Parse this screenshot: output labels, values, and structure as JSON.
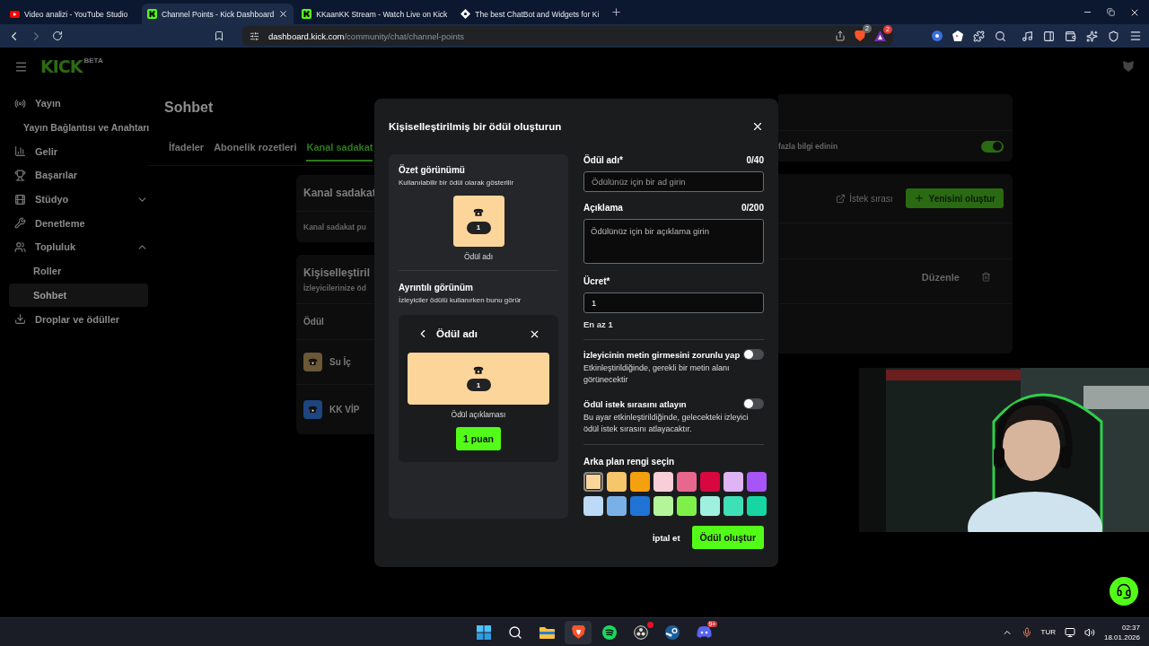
{
  "browser": {
    "tabs": [
      {
        "title": "Video analizi - YouTube Studio",
        "kind": "video",
        "selected": false
      },
      {
        "title": "Channel Points - Kick Dashboard",
        "kind": "kick",
        "selected": true
      },
      {
        "title": "KKaanKK Stream - Watch Live on Kick",
        "kind": "kick",
        "selected": false
      },
      {
        "title": "The best ChatBot and Widgets for Ki",
        "kind": "bot",
        "selected": false
      }
    ],
    "url_host": "dashboard.kick.com",
    "url_path": "/community/chat/channel-points",
    "shield_badge": "2",
    "triangle_badge": "2"
  },
  "header": {
    "logo": "KICK",
    "logo_tag": "BETA"
  },
  "sidebar": {
    "items": [
      {
        "label": "Yayın",
        "kind": "broadcast",
        "selected": false,
        "children": [
          {
            "label": "Yayın Bağlantısı ve Anahtarı",
            "selected": false
          }
        ]
      },
      {
        "label": "Gelir",
        "kind": "chart",
        "selected": false
      },
      {
        "label": "Başarılar",
        "kind": "trophy",
        "selected": false
      },
      {
        "label": "Stüdyo",
        "kind": "film",
        "selected": false,
        "expanded": false
      },
      {
        "label": "Denetleme",
        "kind": "wrench",
        "selected": false
      },
      {
        "label": "Topluluk",
        "kind": "users",
        "selected": false,
        "expanded": true,
        "children": [
          {
            "label": "Roller",
            "selected": false
          },
          {
            "label": "Sohbet",
            "selected": true
          }
        ]
      },
      {
        "label": "Droplar ve ödüller",
        "kind": "drop",
        "selected": false
      }
    ]
  },
  "page": {
    "title": "Sohbet",
    "tabs": [
      {
        "label": "İfadeler",
        "selected": false
      },
      {
        "label": "Abonelik rozetleri",
        "selected": false
      },
      {
        "label": "Kanal sadakat",
        "selected": true
      }
    ],
    "loyalty_card": {
      "title": "Kanal sadakat",
      "row_text": "Kanal sadakat pu",
      "row_link": "fazla bilgi edinin",
      "on": true
    },
    "rewards_card": {
      "title": "Kişiselleştiril",
      "subtitle": "İzleyicilerinize öd",
      "queue_link": "İstek sırası",
      "create_button": "Yenisini oluştur",
      "column_1": "Ödül",
      "rows": [
        {
          "name": "Su İç",
          "color": "#6b5836",
          "action": "Düzenle"
        },
        {
          "name": "KK VİP",
          "color": "#1d4580"
        }
      ]
    }
  },
  "modal": {
    "title": "Kişiselleştirilmiş bir ödül oluşturun",
    "summary": {
      "title": "Özet görünümü",
      "subtitle": "Kullanılabilir bir ödül olarak gösterilir",
      "cost": "1",
      "name": "Ödül adı"
    },
    "detail": {
      "title": "Ayrıntılı görünüm",
      "subtitle": "İzleyiciler ödülü kullanırken bunu görür",
      "name": "Ödül adı",
      "cost": "1",
      "description": "Ödül açıklaması",
      "button": "1 puan"
    },
    "name_field": {
      "label": "Ödül adı*",
      "counter": "0/40",
      "placeholder": "Ödülünüz için bir ad girin"
    },
    "description_field": {
      "label": "Açıklama",
      "counter": "0/200",
      "placeholder": "Ödülünüz için bir açıklama girin"
    },
    "cost_field": {
      "label": "Ücret*",
      "value": "1",
      "hint": "En az 1"
    },
    "toggles": [
      {
        "label": "İzleyicinin metin girmesini zorunlu yap",
        "description": "Etkinleştirildiğinde, gerekli bir metin alanı görünecektir",
        "on": false
      },
      {
        "label": "Ödül istek sırasını atlayın",
        "description": "Bu ayar etkinleştirildiğinde, gelecekteki izleyici ödül istek sırasını atlayacaktır.",
        "on": false
      }
    ],
    "color_label": "Arka plan rengi seçin",
    "swatches": [
      {
        "color": "#fcd59b",
        "selected": true
      },
      {
        "color": "#f7c56a",
        "selected": false
      },
      {
        "color": "#f5a00f",
        "selected": false
      },
      {
        "color": "#f8cfd9",
        "selected": false
      },
      {
        "color": "#e8678e",
        "selected": false
      },
      {
        "color": "#d8073f",
        "selected": false
      },
      {
        "color": "#dfb4f5",
        "selected": false
      },
      {
        "color": "#a855f7",
        "selected": false
      },
      {
        "color": "#bcd9f5",
        "selected": false
      },
      {
        "color": "#7ab0e8",
        "selected": false
      },
      {
        "color": "#1f74d6",
        "selected": false
      },
      {
        "color": "#b5f59a",
        "selected": false
      },
      {
        "color": "#7ff04a",
        "selected": false
      },
      {
        "color": "#a0f0df",
        "selected": false
      },
      {
        "color": "#3fe0b8",
        "selected": false
      },
      {
        "color": "#16d6a4",
        "selected": false
      }
    ],
    "cancel": "İptal et",
    "submit": "Ödül oluştur"
  },
  "taskbar": {
    "apps": [
      {
        "kind": "start",
        "active": false,
        "notification": false
      },
      {
        "kind": "search",
        "active": false,
        "notification": false
      },
      {
        "kind": "folder",
        "active": false,
        "notification": false
      },
      {
        "kind": "lion",
        "active": true,
        "notification": false
      },
      {
        "kind": "music",
        "active": false,
        "notification": false
      },
      {
        "kind": "record",
        "active": false,
        "notification": true
      },
      {
        "kind": "game",
        "active": false,
        "notification": false
      },
      {
        "kind": "chat",
        "active": false,
        "notification": false,
        "badge": "9+"
      }
    ],
    "language": "TUR",
    "time": "02:37",
    "date": "18.01.2026"
  }
}
